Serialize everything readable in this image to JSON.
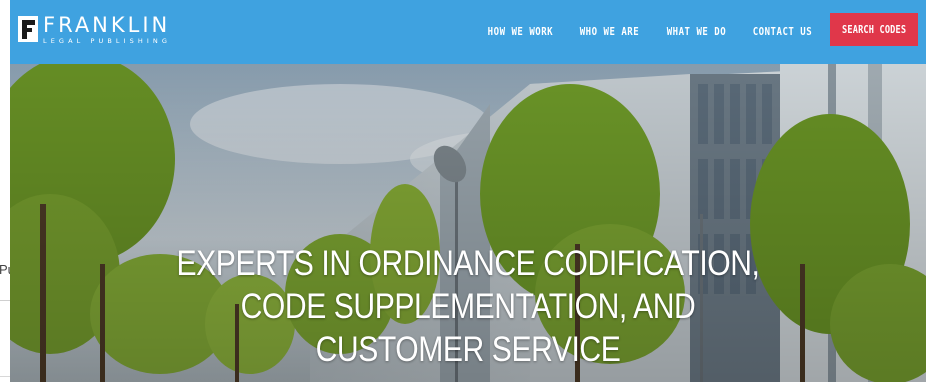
{
  "background_page": {
    "fragment_text": "Pu"
  },
  "header": {
    "logo": {
      "name": "FRANKLIN",
      "subtitle": "LEGAL PUBLISHING"
    },
    "nav": [
      {
        "label": "HOW WE WORK"
      },
      {
        "label": "WHO WE ARE"
      },
      {
        "label": "WHAT WE DO"
      },
      {
        "label": "CONTACT US"
      }
    ],
    "cta_label": "SEARCH CODES"
  },
  "hero": {
    "headline_lines": [
      "EXPERTS IN ORDINANCE CODIFICATION,",
      "CODE SUPPLEMENTATION, AND",
      "CUSTOMER SERVICE"
    ]
  },
  "colors": {
    "nav_bg": "#3fa2e0",
    "cta_bg": "#e0374a",
    "text": "#ffffff"
  }
}
